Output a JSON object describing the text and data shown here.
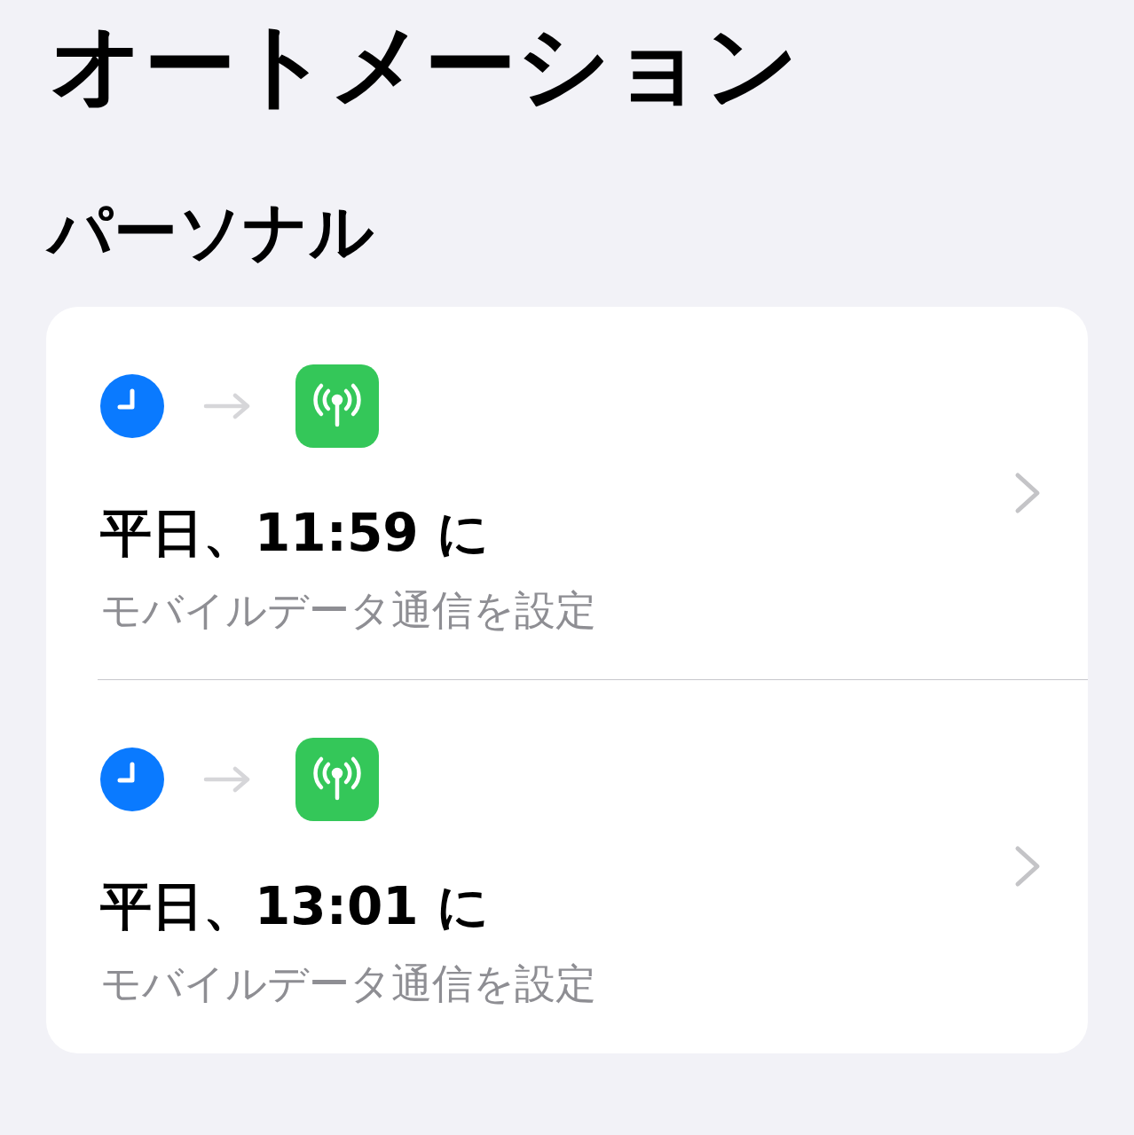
{
  "title": "オートメーション",
  "section": "パーソナル",
  "automations": [
    {
      "title": "平日、11:59 に",
      "subtitle": "モバイルデータ通信を設定"
    },
    {
      "title": "平日、13:01 に",
      "subtitle": "モバイルデータ通信を設定"
    }
  ]
}
